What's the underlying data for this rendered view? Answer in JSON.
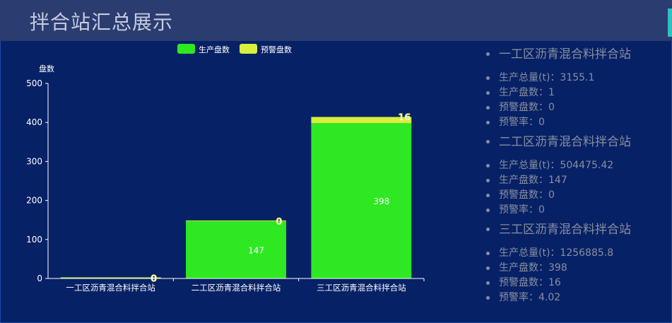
{
  "header": {
    "title": "拌合站汇总展示"
  },
  "chart_data": {
    "type": "bar",
    "stacked": true,
    "ylabel": "盘数",
    "ylim": [
      0,
      500
    ],
    "yticks": [
      0,
      100,
      200,
      300,
      400,
      500
    ],
    "legend_position": "top-center",
    "categories": [
      "一工区沥青混合料拌合站",
      "二工区沥青混合料拌合站",
      "三工区沥青混合料拌合站"
    ],
    "series": [
      {
        "name": "生产盘数",
        "color": "#2ee821",
        "values": [
          1,
          147,
          398
        ]
      },
      {
        "name": "预警盘数",
        "color": "#d9ef3b",
        "values": [
          0,
          0,
          16
        ]
      }
    ]
  },
  "stations": [
    {
      "name": "一工区沥青混合料拌合站",
      "stats": [
        {
          "label": "生产总量(t)：",
          "value": "3155.1"
        },
        {
          "label": "生产盘数：",
          "value": "1"
        },
        {
          "label": "预警盘数：",
          "value": "0"
        },
        {
          "label": "预警率：",
          "value": "0"
        }
      ]
    },
    {
      "name": "二工区沥青混合料拌合站",
      "stats": [
        {
          "label": "生产总量(t)：",
          "value": "504475.42"
        },
        {
          "label": "生产盘数：",
          "value": "147"
        },
        {
          "label": "预警盘数：",
          "value": "0"
        },
        {
          "label": "预警率：",
          "value": "0"
        }
      ]
    },
    {
      "name": "三工区沥青混合料拌合站",
      "stats": [
        {
          "label": "生产总量(t)：",
          "value": "1256885.8"
        },
        {
          "label": "生产盘数：",
          "value": "398"
        },
        {
          "label": "预警盘数：",
          "value": "16"
        },
        {
          "label": "预警率：",
          "value": "4.02"
        }
      ]
    }
  ]
}
